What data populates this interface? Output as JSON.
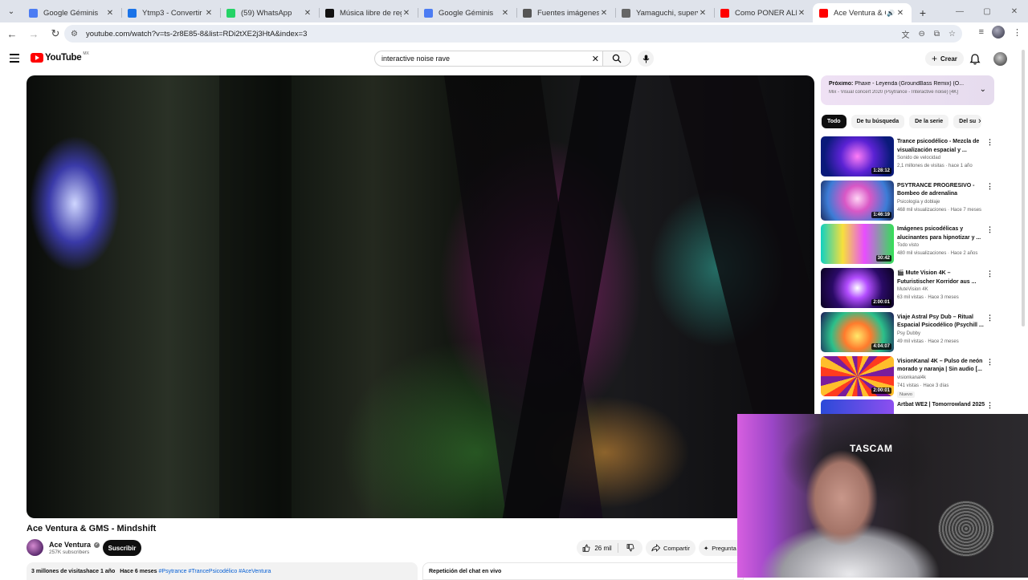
{
  "browser": {
    "tabs": [
      {
        "title": "Google Géminis",
        "favicon": "gemini-icon",
        "color": "#4c7cf3"
      },
      {
        "title": "Ytmp3 - Convertir",
        "favicon": "ytmp3-icon",
        "color": "#1a73e8"
      },
      {
        "title": "(59) WhatsApp",
        "favicon": "whatsapp-icon",
        "color": "#25d366"
      },
      {
        "title": "Música libre de regal",
        "favicon": "artlist-icon",
        "color": "#111111"
      },
      {
        "title": "Google Géminis",
        "favicon": "gemini-icon",
        "color": "#4c7cf3"
      },
      {
        "title": "Fuentes imágenes Ta",
        "favicon": "settings-icon",
        "color": "#555555"
      },
      {
        "title": "Yamaguchi, supervivi",
        "favicon": "wikipedia-icon",
        "color": "#666666"
      },
      {
        "title": "Como PONER ALERT",
        "favicon": "youtube-icon",
        "color": "#ff0000"
      },
      {
        "title": "Ace Ventura & G",
        "favicon": "youtube-icon",
        "color": "#ff0000",
        "active": true
      }
    ],
    "url": "youtube.com/watch?v=ts-2r8E85-8&list=RDi2tXE2j3HtA&index=3"
  },
  "youtube": {
    "logo_text": "YouTube",
    "country_code": "MX",
    "search_value": "interactive noise rave",
    "create_label": "Crear",
    "brand_color": "#ff0000"
  },
  "video": {
    "title": "Ace Ventura & GMS - Mindshift",
    "channel": "Ace Ventura",
    "subscribers": "257K subscribers",
    "subscribe_label": "Suscribir",
    "likes": "26 mil",
    "share_label": "Compartir",
    "ask_label": "Pregunta",
    "views_time": "3 millones de visitashace 1 año",
    "released": "Hace 6 meses",
    "hashtags": "#Psytrance #TrancePsicodélico #AceVentura",
    "chat_replay": "Repetición del chat en vivo"
  },
  "next_up": {
    "label": "Próximo:",
    "title": "Phaxe - Leyenda (GroundBass Remix) (O...",
    "subtitle": "Mix - Visual concert 2020 (Psytrance - Interactive noise) [4K]"
  },
  "chips": [
    "Todo",
    "De tu búsqueda",
    "De la serie",
    "Del su"
  ],
  "related": [
    {
      "title": "Trance psicodélico - Mezcla de visualización espacial y ...",
      "channel": "Sonido de velocidad",
      "meta": "2,1 millones de visitas · hace 1 año",
      "duration": "1:28:12",
      "badge": ""
    },
    {
      "title": "PSYTRANCE PROGRESIVO - Bombeo de adrenalina",
      "channel": "Psicología y doblaje",
      "meta": "468 mil visualizaciones · Hace 7 meses",
      "duration": "1:46:19",
      "badge": ""
    },
    {
      "title": "Imágenes psicodélicas y alucinantes para hipnotizar y ...",
      "channel": "Todo visto",
      "meta": "480 mil visualizaciones · Hace 2 años",
      "duration": "30:42",
      "badge": ""
    },
    {
      "title": "🎬 Mute Vision 4K – Futuristischer Korridor aus ...",
      "channel": "MuteVision 4K",
      "meta": "63 mil vistas · Hace 3 meses",
      "duration": "2:00:01",
      "badge": ""
    },
    {
      "title": "Viaje Astral Psy Dub – Ritual Espacial Psicodélico (Psychill ...",
      "channel": "Psy Dubby",
      "meta": "49 mil vistas · Hace 2 meses",
      "duration": "4:04:07",
      "badge": ""
    },
    {
      "title": "VisionKanal 4K – Pulso de neón morado y naranja | Sin audio [...",
      "channel": "visionkanal4k",
      "meta": "741 vistas · Hace 3 días",
      "duration": "2:00:01",
      "badge": "Nuevo"
    },
    {
      "title": "Artbat WE2 | Tomorrowland 2025",
      "channel": "",
      "meta": "",
      "duration": "",
      "badge": ""
    }
  ],
  "webcam": {
    "cap_text": "TASCAM"
  }
}
